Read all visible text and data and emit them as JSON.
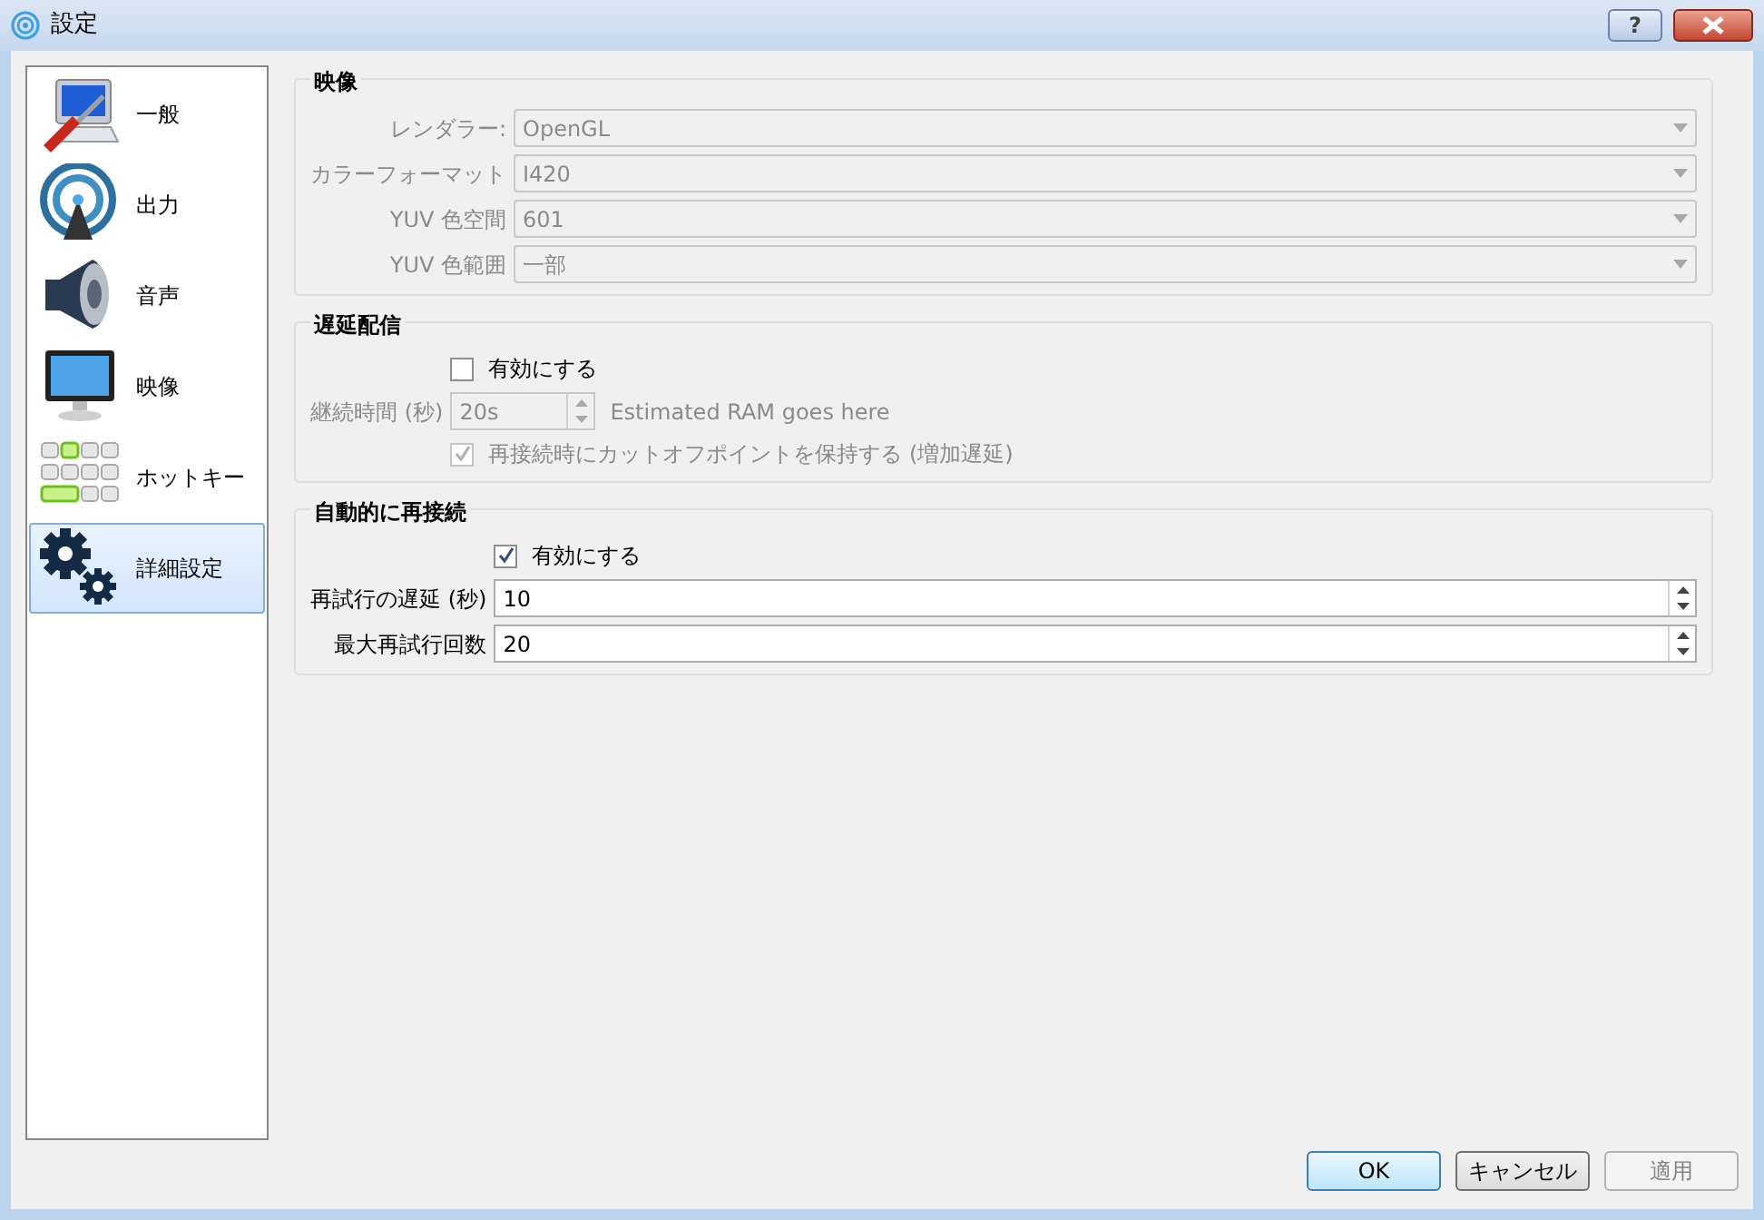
{
  "window": {
    "title": "設定",
    "help_button": "?"
  },
  "sidebar": {
    "items": [
      {
        "label": "一般",
        "selected": false
      },
      {
        "label": "出力",
        "selected": false
      },
      {
        "label": "音声",
        "selected": false
      },
      {
        "label": "映像",
        "selected": false
      },
      {
        "label": "ホットキー",
        "selected": false
      },
      {
        "label": "詳細設定",
        "selected": true
      }
    ]
  },
  "groups": [
    {
      "title": "映像",
      "rows": [
        {
          "kind": "select",
          "label": "レンダラー:",
          "value": "OpenGL",
          "disabled": true
        },
        {
          "kind": "select",
          "label": "カラーフォーマット",
          "value": "I420",
          "disabled": true
        },
        {
          "kind": "select",
          "label": "YUV 色空間",
          "value": "601",
          "disabled": true
        },
        {
          "kind": "select",
          "label": "YUV 色範囲",
          "value": "一部",
          "disabled": true
        }
      ]
    },
    {
      "title": "遅延配信",
      "rows": [
        {
          "kind": "checkbox",
          "label": "有効にする",
          "checked": false,
          "disabled": false
        },
        {
          "kind": "spin",
          "label": "継続時間 (秒)",
          "value": "20s",
          "note": "Estimated RAM goes here",
          "disabled": true
        },
        {
          "kind": "checkbox",
          "label": "再接続時にカットオフポイントを保持する (増加遅延)",
          "checked": true,
          "disabled": true
        }
      ]
    },
    {
      "title": "自動的に再接続",
      "rows": [
        {
          "kind": "checkbox",
          "label": "有効にする",
          "checked": true,
          "disabled": false
        },
        {
          "kind": "spin",
          "label": "再試行の遅延 (秒)",
          "value": "10",
          "disabled": false
        },
        {
          "kind": "spin",
          "label": "最大再試行回数",
          "value": "20",
          "disabled": false
        }
      ]
    }
  ],
  "buttons": [
    {
      "label": "OK",
      "default": true,
      "disabled": false
    },
    {
      "label": "キャンセル",
      "default": false,
      "disabled": false
    },
    {
      "label": "適用",
      "default": false,
      "disabled": true
    }
  ]
}
